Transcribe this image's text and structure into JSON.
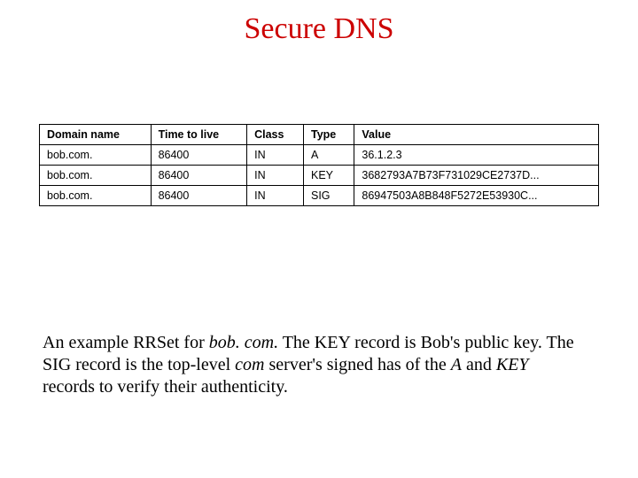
{
  "title": "Secure DNS",
  "table": {
    "headers": [
      "Domain name",
      "Time to live",
      "Class",
      "Type",
      "Value"
    ],
    "rows": [
      {
        "domain": "bob.com.",
        "ttl": "86400",
        "class": "IN",
        "type": "A",
        "value": "36.1.2.3"
      },
      {
        "domain": "bob.com.",
        "ttl": "86400",
        "class": "IN",
        "type": "KEY",
        "value": "3682793A7B73F731029CE2737D..."
      },
      {
        "domain": "bob.com.",
        "ttl": "86400",
        "class": "IN",
        "type": "SIG",
        "value": "86947503A8B848F5272E53930C..."
      }
    ]
  },
  "caption": {
    "p1a": "An example RRSet for ",
    "p1b": "bob. com.",
    "p1c": "  The KEY record is Bob's public key.  The SIG record is the top-level ",
    "p1d": "com",
    "p1e": " server's signed has of the ",
    "p1f": "A",
    "p1g": " and ",
    "p1h": "KEY",
    "p1i": "  records to verify their authenticity."
  }
}
